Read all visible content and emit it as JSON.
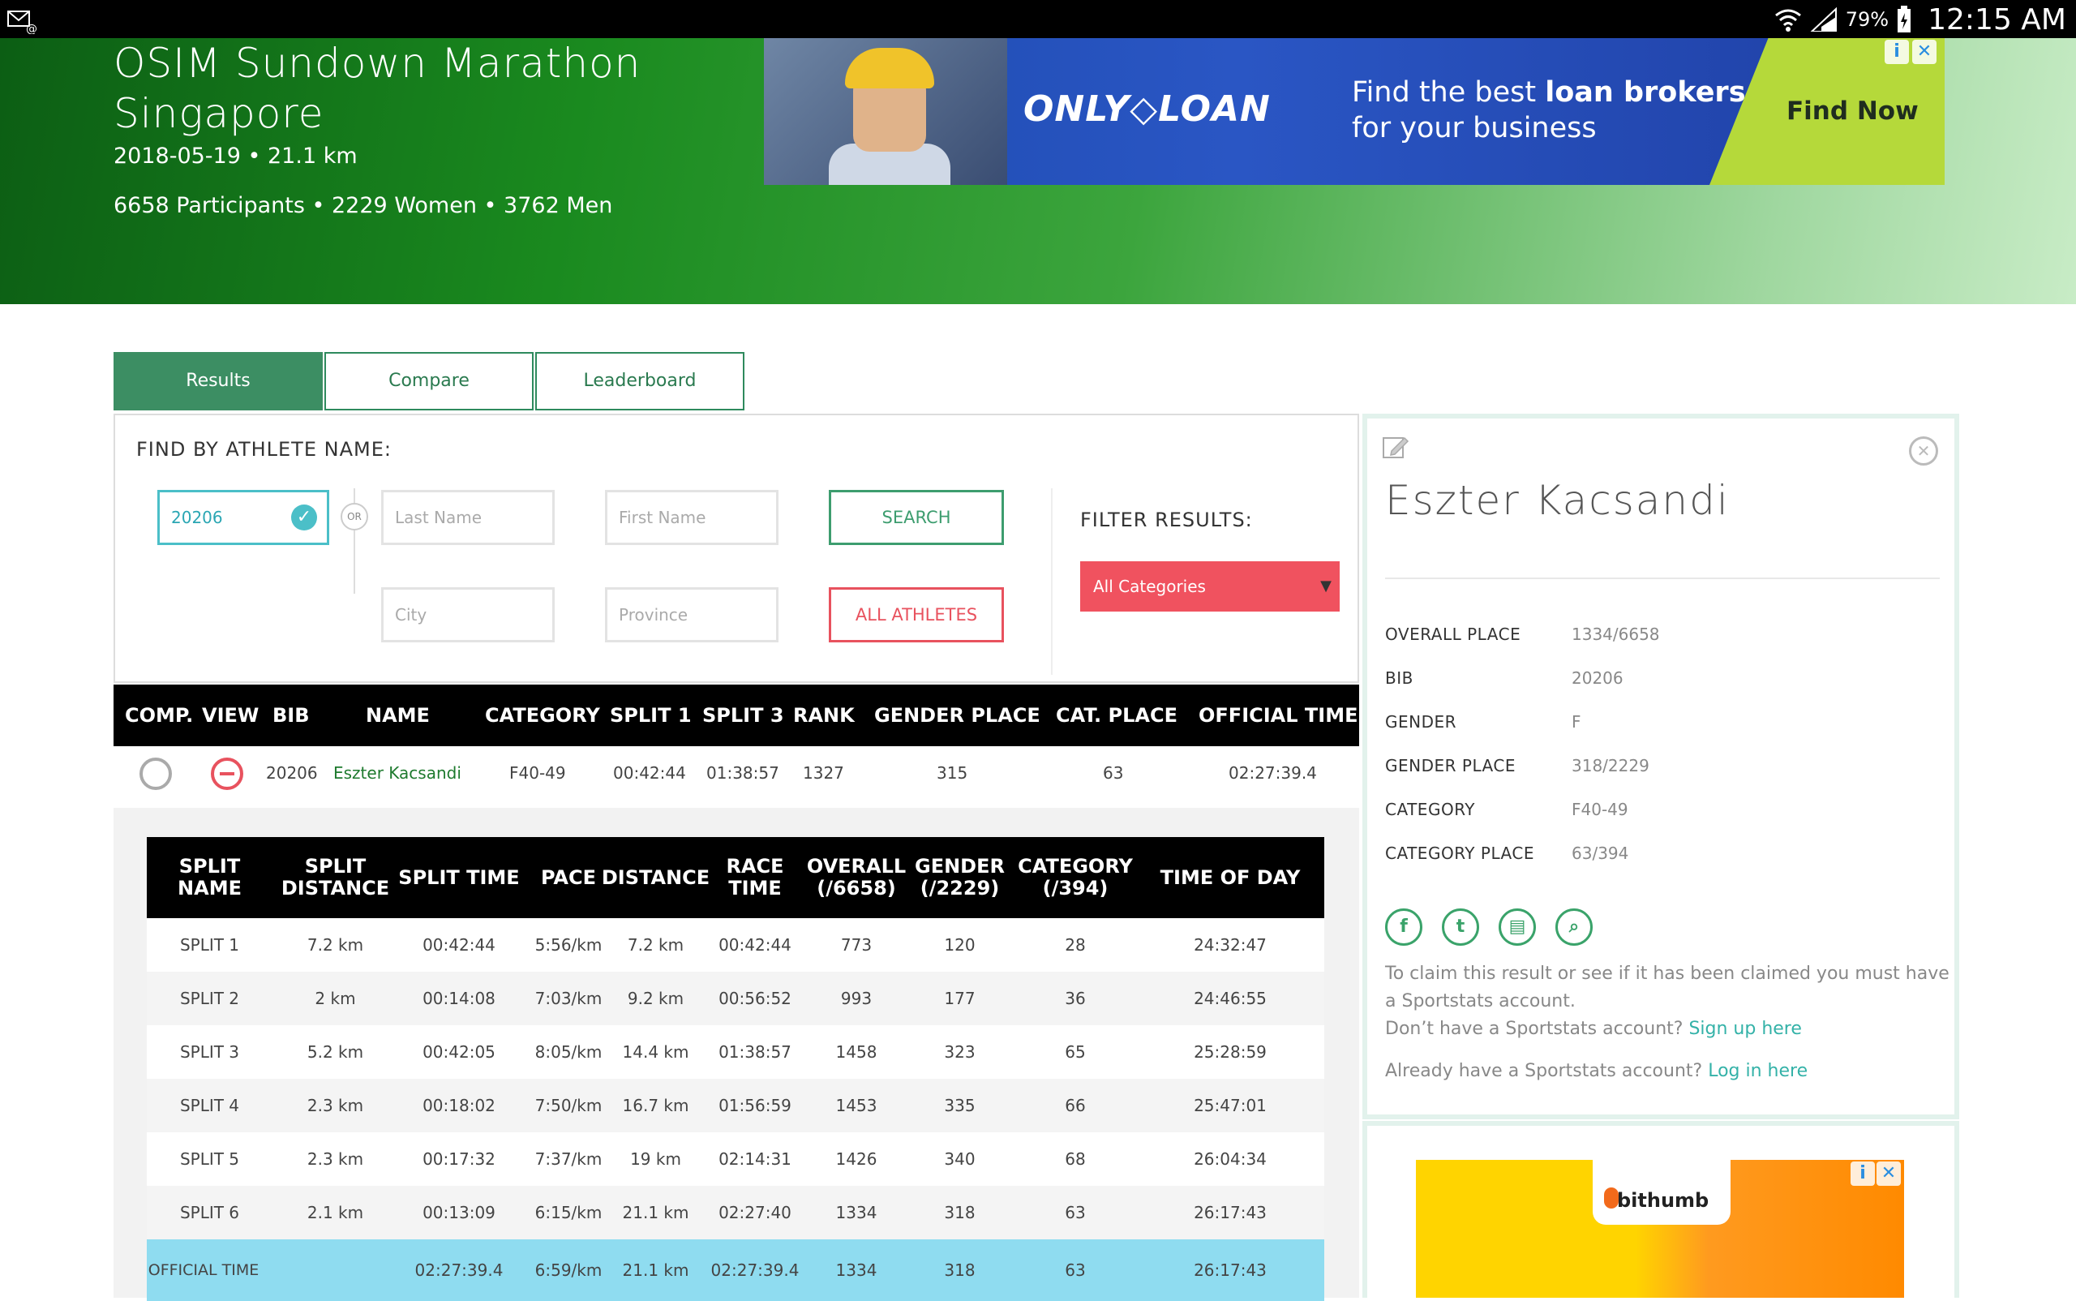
{
  "status_bar": {
    "battery": "79%",
    "time": "12:15 AM"
  },
  "event": {
    "title_line1": "OSIM Sundown Marathon",
    "title_line2": "Singapore",
    "date_distance": "2018-05-19 • 21.1 km",
    "participants": "6658 Participants • 2229 Women • 3762 Men"
  },
  "ad_top": {
    "brand": "ONLY◇LOAN",
    "tagline_1a": "Find the best ",
    "tagline_1b": "loan brokers",
    "tagline_2": "for your business",
    "cta": "Find Now"
  },
  "tabs": [
    "Results",
    "Compare",
    "Leaderboard"
  ],
  "search": {
    "title": "FIND BY ATHLETE NAME:",
    "bib_value": "20206",
    "or": "OR",
    "last_name": "Last Name",
    "first_name": "First Name",
    "city": "City",
    "province": "Province",
    "search_button": "SEARCH",
    "all_button": "ALL ATHLETES",
    "filter_title": "FILTER RESULTS:",
    "filter_value": "All Categories"
  },
  "results": {
    "headers": [
      "COMP.",
      "VIEW",
      "BIB",
      "NAME",
      "CATEGORY",
      "SPLIT 1",
      "SPLIT 3",
      "RANK",
      "GENDER PLACE",
      "CAT. PLACE",
      "OFFICIAL TIME"
    ],
    "row": {
      "bib": "20206",
      "name": "Eszter Kacsandi",
      "category": "F40-49",
      "split1": "00:42:44",
      "split3": "01:38:57",
      "rank": "1327",
      "gender_place": "315",
      "cat_place": "63",
      "official_time": "02:27:39.4"
    }
  },
  "splits": {
    "headers": [
      "SPLIT NAME",
      "SPLIT DISTANCE",
      "SPLIT TIME",
      "PACE",
      "DISTANCE",
      "RACE TIME",
      "OVERALL (/6658)",
      "GENDER (/2229)",
      "CATEGORY (/394)",
      "TIME OF DAY"
    ],
    "rows": [
      [
        "SPLIT 1",
        "7.2 km",
        "00:42:44",
        "5:56/km",
        "7.2 km",
        "00:42:44",
        "773",
        "120",
        "28",
        "24:32:47"
      ],
      [
        "SPLIT 2",
        "2 km",
        "00:14:08",
        "7:03/km",
        "9.2 km",
        "00:56:52",
        "993",
        "177",
        "36",
        "24:46:55"
      ],
      [
        "SPLIT 3",
        "5.2 km",
        "00:42:05",
        "8:05/km",
        "14.4 km",
        "01:38:57",
        "1458",
        "323",
        "65",
        "25:28:59"
      ],
      [
        "SPLIT 4",
        "2.3 km",
        "00:18:02",
        "7:50/km",
        "16.7 km",
        "01:56:59",
        "1453",
        "335",
        "66",
        "25:47:01"
      ],
      [
        "SPLIT 5",
        "2.3 km",
        "00:17:32",
        "7:37/km",
        "19 km",
        "02:14:31",
        "1426",
        "340",
        "68",
        "26:04:34"
      ],
      [
        "SPLIT 6",
        "2.1 km",
        "00:13:09",
        "6:15/km",
        "21.1 km",
        "02:27:40",
        "1334",
        "318",
        "63",
        "26:17:43"
      ],
      [
        "OFFICIAL TIME",
        "",
        "02:27:39.4",
        "6:59/km",
        "21.1 km",
        "02:27:39.4",
        "1334",
        "318",
        "63",
        "26:17:43"
      ]
    ]
  },
  "athlete": {
    "name": "Eszter Kacsandi",
    "fields": [
      {
        "label": "OVERALL PLACE",
        "value": "1334/6658"
      },
      {
        "label": "BIB",
        "value": "20206"
      },
      {
        "label": "GENDER",
        "value": "F"
      },
      {
        "label": "GENDER PLACE",
        "value": "318/2229"
      },
      {
        "label": "CATEGORY",
        "value": "F40-49"
      },
      {
        "label": "CATEGORY PLACE",
        "value": "63/394"
      }
    ],
    "claim_text": "To claim this result or see if it has been claimed you must have a Sportstats account.",
    "no_account": "Don’t have a Sportstats account?",
    "sign_up": "Sign up here",
    "have_account": "Already have a Sportstats account?",
    "log_in": "Log in here"
  },
  "ad_bottom": {
    "brand": "bithumb"
  }
}
